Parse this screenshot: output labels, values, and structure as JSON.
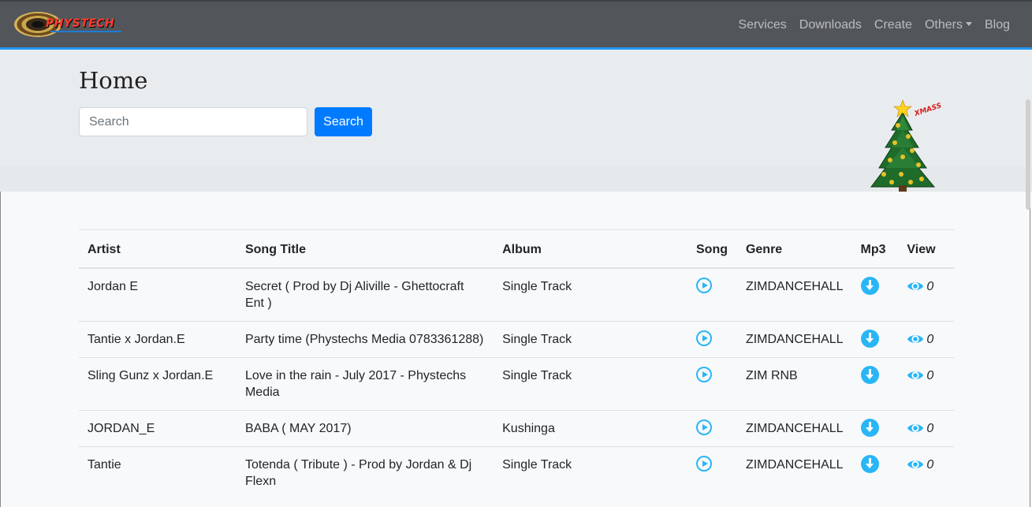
{
  "navbar": {
    "logo_text": "PHYSTECH",
    "links": [
      "Services",
      "Downloads",
      "Create",
      "Others",
      "Blog"
    ]
  },
  "header": {
    "title": "Home",
    "search_placeholder": "Search",
    "search_button": "Search",
    "decoration_text": "XMASS"
  },
  "table": {
    "columns": [
      "Artist",
      "Song Title",
      "Album",
      "Song",
      "Genre",
      "Mp3",
      "View"
    ],
    "rows": [
      {
        "artist": "Jordan E",
        "title": "Secret ( Prod by Dj Aliville - Ghettocraft Ent )",
        "album": "Single Track",
        "genre": "ZIMDANCEHALL",
        "views": "0"
      },
      {
        "artist": "Tantie x Jordan.E",
        "title": "Party time (Phystechs Media 0783361288)",
        "album": "Single Track",
        "genre": "ZIMDANCEHALL",
        "views": "0"
      },
      {
        "artist": "Sling Gunz x Jordan.E",
        "title": "Love in the rain - July 2017 - Phystechs Media",
        "album": "Single Track",
        "genre": "ZIM RNB",
        "views": "0"
      },
      {
        "artist": "JORDAN_E",
        "title": "BABA ( MAY 2017)",
        "album": "Kushinga",
        "genre": "ZIMDANCEHALL",
        "views": "0"
      },
      {
        "artist": "Tantie",
        "title": "Totenda ( Tribute ) - Prod by Jordan & Dj Flexn",
        "album": "Single Track",
        "genre": "ZIMDANCEHALL",
        "views": "0"
      }
    ]
  },
  "icons": {
    "song": "play-circle-icon",
    "mp3": "download-icon",
    "view": "eye-icon"
  },
  "colors": {
    "navbar": "#52565b",
    "accent": "#2196f3",
    "button": "#007bff",
    "icon": "#29b6f6"
  }
}
